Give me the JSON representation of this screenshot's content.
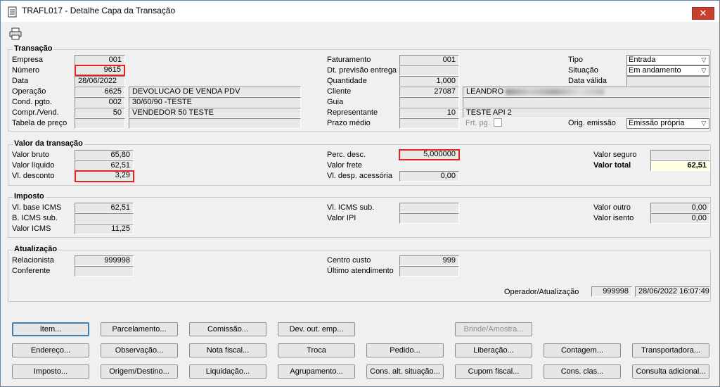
{
  "window": {
    "title": "TRAFL017 - Detalhe Capa da Transação",
    "close": "✕"
  },
  "transacao": {
    "title": "Transação",
    "empresa": {
      "label": "Empresa",
      "value": "001"
    },
    "numero": {
      "label": "Número",
      "value": "9615"
    },
    "data": {
      "label": "Data",
      "value": "28/06/2022"
    },
    "operacao": {
      "label": "Operação",
      "code": "6625",
      "desc": "DEVOLUCAO DE VENDA PDV"
    },
    "cond_pgto": {
      "label": "Cond. pgto.",
      "code": "002",
      "desc": "30/60/90 -TESTE"
    },
    "compr_vend": {
      "label": "Compr./Vend.",
      "code": "50",
      "desc": "VENDEDOR 50 TESTE"
    },
    "tabela_preco": {
      "label": "Tabela de preço",
      "code": "",
      "desc": ""
    },
    "faturamento": {
      "label": "Faturamento",
      "value": "001"
    },
    "dt_prev": {
      "label": "Dt. previsão entrega",
      "value": ""
    },
    "quantidade": {
      "label": "Quantidade",
      "value": "1,000"
    },
    "cliente": {
      "label": "Cliente",
      "code": "27087",
      "desc": "LEANDRO"
    },
    "guia": {
      "label": "Guia",
      "value": ""
    },
    "representante": {
      "label": "Representante",
      "code": "10",
      "desc": "TESTE API 2"
    },
    "prazo_medio": {
      "label": "Prazo médio",
      "value": ""
    },
    "frt_pg": {
      "label": "Frt. pg."
    },
    "tipo": {
      "label": "Tipo",
      "value": "Entrada"
    },
    "situacao": {
      "label": "Situação",
      "value": "Em andamento"
    },
    "data_valida": {
      "label": "Data válida",
      "value": ""
    },
    "orig_emissao": {
      "label": "Orig. emissão",
      "value": "Emissão própria"
    }
  },
  "valor": {
    "title": "Valor da transação",
    "bruto": {
      "label": "Valor bruto",
      "value": "65,80"
    },
    "liquido": {
      "label": "Valor líquido",
      "value": "62,51"
    },
    "desconto": {
      "label": "Vl. desconto",
      "value": "3,29"
    },
    "perc_desc": {
      "label": "Perc. desc.",
      "value": "5,000000"
    },
    "frete": {
      "label": "Valor frete",
      "value": ""
    },
    "desp_acess": {
      "label": "Vl. desp. acessória",
      "value": "0,00"
    },
    "seguro": {
      "label": "Valor seguro",
      "value": ""
    },
    "total": {
      "label": "Valor total",
      "value": "62,51"
    }
  },
  "imposto": {
    "title": "Imposto",
    "base_icms": {
      "label": "Vl. base ICMS",
      "value": "62,51"
    },
    "b_icms_sub": {
      "label": "B. ICMS sub.",
      "value": ""
    },
    "icms": {
      "label": "Valor ICMS",
      "value": "11,25"
    },
    "icms_sub": {
      "label": "Vl. ICMS sub.",
      "value": ""
    },
    "ipi": {
      "label": "Valor IPI",
      "value": ""
    },
    "outro": {
      "label": "Valor outro",
      "value": "0,00"
    },
    "isento": {
      "label": "Valor isento",
      "value": "0,00"
    }
  },
  "atualizacao": {
    "title": "Atualização",
    "relacionista": {
      "label": "Relacionista",
      "value": "999998"
    },
    "conferente": {
      "label": "Conferente",
      "value": ""
    },
    "centro_custo": {
      "label": "Centro custo",
      "value": "999"
    },
    "ultimo_atend": {
      "label": "Último atendimento",
      "value": ""
    },
    "operador": {
      "label": "Operador/Atualização",
      "code": "999998",
      "datetime": "28/06/2022 16:07:49"
    }
  },
  "buttons": {
    "row1": [
      "Item...",
      "Parcelamento...",
      "Comissão...",
      "Dev. out. emp...",
      "Brinde/Amostra..."
    ],
    "row2": [
      "Endereço...",
      "Observação...",
      "Nota fiscal...",
      "Troca",
      "Pedido...",
      "Liberação...",
      "Contagem...",
      "Transportadora..."
    ],
    "row3": [
      "Imposto...",
      "Origem/Destino...",
      "Liquidação...",
      "Agrupamento...",
      "Cons. alt. situação...",
      "Cupom fiscal...",
      "Cons. clas...",
      "Consulta adicional..."
    ]
  }
}
